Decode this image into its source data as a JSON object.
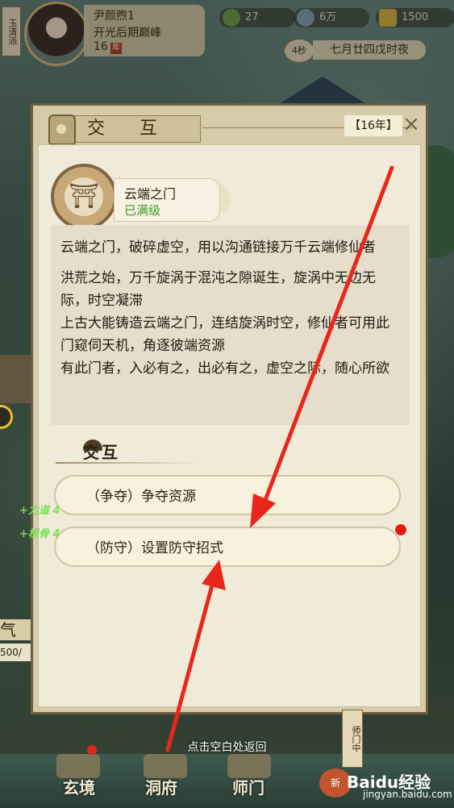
{
  "header": {
    "sect_name": "玉清派",
    "player_name": "尹颜煦1",
    "realm": "开光后期巅峰",
    "age": "16",
    "age_stamp": "年",
    "resources": [
      "27",
      "6万",
      "1500"
    ],
    "timer": "4秒",
    "date": "七月廿四戊时夜"
  },
  "dialog": {
    "title": "交  互",
    "year": "【16年】",
    "item_name": "云端之门",
    "item_level": "已满级",
    "description": [
      "云端之门，破碎虚空，用以沟通链接万千云端修仙者",
      "洪荒之始，万千旋涡于混沌之隙诞生，旋涡中无边无际，时空凝滞",
      "上古大能铸造云端之门，连结旋涡时空，修仙者可用此门窥伺天机，角逐彼端资源",
      "有此门者，入必有之，出必有之，虚空之际，随心所欲"
    ],
    "section_title": "交互",
    "options": [
      "（争夺）争夺资源",
      "（防守）设置防守招式"
    ]
  },
  "stats": [
    "+力道 4",
    "+根骨 4"
  ],
  "side": {
    "qi": "气合",
    "hp": "500/"
  },
  "bottom": {
    "return_hint": "点击空白处返回",
    "nav": [
      "玄境",
      "洞府",
      "师门"
    ],
    "new_label": "新",
    "master_tag": "师门中",
    "watermark_logo": "Baidu经验",
    "watermark_url": "jingyan.baidu.com"
  },
  "colors": {
    "panel_bg": "#f0ebd8",
    "level_green": "#3d9a2a",
    "stat_green": "#7be05a",
    "arrow_red": "#e8261c",
    "notify_red": "#e21c12"
  }
}
